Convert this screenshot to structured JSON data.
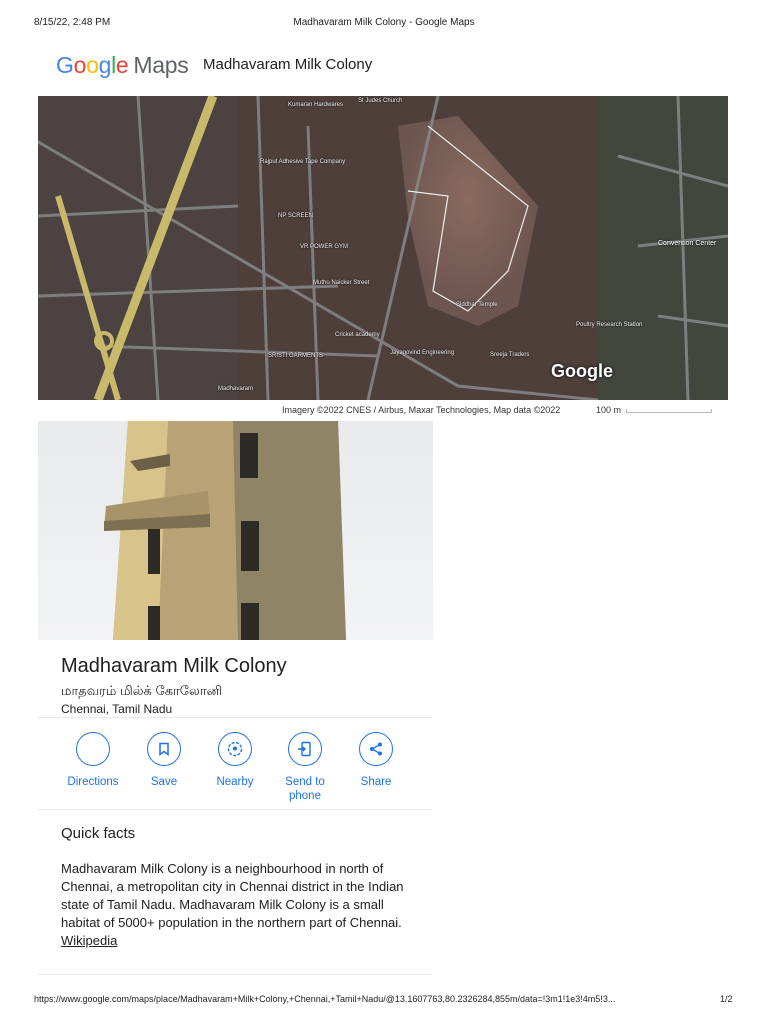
{
  "print_header": {
    "datetime": "8/15/22, 2:48 PM",
    "page_title": "Madhavaram Milk Colony - Google Maps"
  },
  "logo": {
    "google": [
      "G",
      "o",
      "o",
      "g",
      "l",
      "e"
    ],
    "maps": "Maps",
    "colors": [
      "#4285f4",
      "#ea4335",
      "#fbbc05",
      "#4285f4",
      "#34a853",
      "#ea4335"
    ]
  },
  "header_title": "Madhavaram Milk Colony",
  "map": {
    "watermark": "Google",
    "labels": [
      "St Judes Church",
      "Kumaran Hardwares",
      "Rajput Adhesive Tape Company",
      "NP SCREEN",
      "VR POWER GYM",
      "Muthu Naicker Street",
      "Siddhar Temple",
      "Sreeja Traders",
      "Jayagovind Engineering",
      "SRISTI GARMENTS",
      "Cricket academy",
      "Poultry Research Station",
      "Convention Center",
      "Madhavaram"
    ]
  },
  "attribution": "Imagery ©2022 CNES / Airbus, Maxar Technologies, Map data ©2022",
  "scale": "100 m",
  "place": {
    "name": "Madhavaram Milk Colony",
    "local_name": "மாதவரம் மில்க் கோலோனி",
    "region": "Chennai, Tamil Nadu"
  },
  "actions": [
    {
      "label": "Directions",
      "icon": "directions-icon"
    },
    {
      "label": "Save",
      "icon": "bookmark-icon"
    },
    {
      "label": "Nearby",
      "icon": "nearby-icon"
    },
    {
      "label": "Send to phone",
      "icon": "send-to-phone-icon"
    },
    {
      "label": "Share",
      "icon": "share-icon"
    }
  ],
  "quick_facts": {
    "heading": "Quick facts",
    "text": "Madhavaram Milk Colony is a neighbourhood in north of Chennai, a metropolitan city in Chennai district in the Indian state of Tamil Nadu. Madhavaram Milk Colony is a small habitat of 5000+ population in the northern part of Chennai. ",
    "link": "Wikipedia"
  },
  "print_footer": {
    "url": "https://www.google.com/maps/place/Madhavaram+Milk+Colony,+Chennai,+Tamil+Nadu/@13.1607763,80.2326284,855m/data=!3m1!1e3!4m5!3...",
    "page": "1/2"
  }
}
